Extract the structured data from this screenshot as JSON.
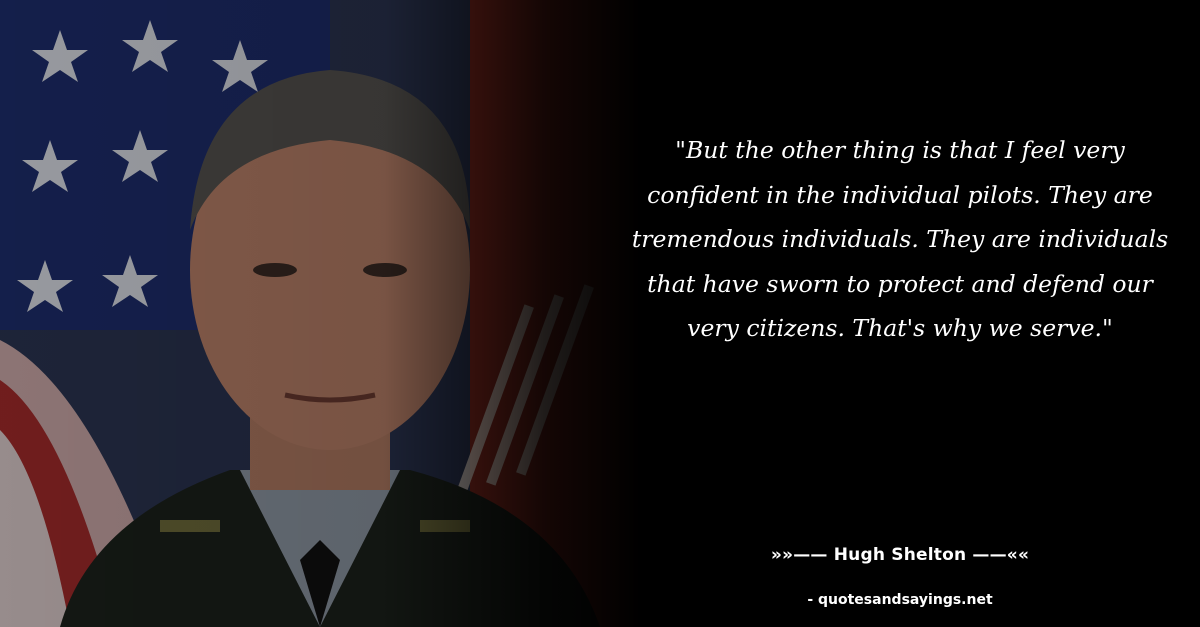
{
  "quote": {
    "text": "\"But the other thing is that I feel very confident in the individual pilots. They are tremendous individuals. They are individuals that have sworn to protect and defend our very citizens. That's why we serve.\""
  },
  "author": {
    "line": "»»—— Hugh Shelton ——««"
  },
  "source": {
    "text": "- quotesandsayings.net"
  },
  "colors": {
    "background": "#000000",
    "text": "#ffffff"
  }
}
